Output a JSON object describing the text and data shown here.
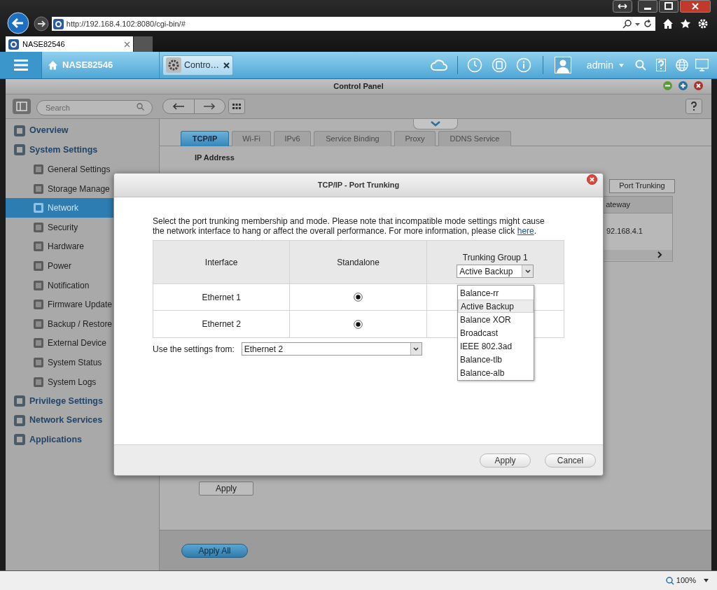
{
  "browser": {
    "url": "http://192.168.4.102:8080/cgi-bin/#",
    "tab": "NASE82546"
  },
  "app_header": {
    "host": "NASE82546",
    "open_app": "Contro…",
    "user": "admin"
  },
  "control_panel": {
    "title": "Control Panel",
    "search": {
      "placeholder": "Search"
    },
    "sidebar": [
      {
        "label": "Overview",
        "selected": false
      },
      {
        "label": "System Settings",
        "selected": false,
        "children": [
          {
            "label": "General Settings",
            "selected": false
          },
          {
            "label": "Storage Manage",
            "selected": false
          },
          {
            "label": "Network",
            "selected": true
          },
          {
            "label": "Security",
            "selected": false
          },
          {
            "label": "Hardware",
            "selected": false
          },
          {
            "label": "Power",
            "selected": false
          },
          {
            "label": "Notification",
            "selected": false
          },
          {
            "label": "Firmware Update",
            "selected": false
          },
          {
            "label": "Backup / Restore",
            "selected": false
          },
          {
            "label": "External Device",
            "selected": false
          },
          {
            "label": "System Status",
            "selected": false
          },
          {
            "label": "System Logs",
            "selected": false
          }
        ]
      },
      {
        "label": "Privilege Settings",
        "selected": false
      },
      {
        "label": "Network Services",
        "selected": false
      },
      {
        "label": "Applications",
        "selected": false
      }
    ],
    "tabs": [
      {
        "label": "TCP/IP",
        "selected": true
      },
      {
        "label": "Wi-Fi",
        "selected": false
      },
      {
        "label": "IPv6",
        "selected": false
      },
      {
        "label": "Service Binding",
        "selected": false
      },
      {
        "label": "Proxy",
        "selected": false
      },
      {
        "label": "DDNS Service",
        "selected": false
      }
    ],
    "section_label": "IP Address",
    "port_trunking_button": "Port Trunking",
    "column_header": "ateway",
    "cell": "92.168.4.1",
    "apply_button": "Apply",
    "apply_all_button": "Apply All"
  },
  "dialog": {
    "title": "TCP/IP - Port Trunking",
    "message": "Select the port trunking membership and mode. Please note that incompatible mode settings might cause the network interface to hang or affect the overall performance. For more information, please click",
    "link": "here",
    "after_link": ".",
    "columns": [
      "Interface",
      "Standalone",
      "Trunking Group 1"
    ],
    "group_mode": "Active Backup",
    "mode_options": [
      {
        "label": "Balance-rr",
        "selected": false
      },
      {
        "label": "Active Backup",
        "selected": true
      },
      {
        "label": "Balance XOR",
        "selected": false
      },
      {
        "label": "Broadcast",
        "selected": false
      },
      {
        "label": "IEEE 802.3ad",
        "selected": false
      },
      {
        "label": "Balance-tlb",
        "selected": false
      },
      {
        "label": "Balance-alb",
        "selected": false
      }
    ],
    "rows": [
      {
        "interface": "Ethernet 1",
        "standalone": true
      },
      {
        "interface": "Ethernet 2",
        "standalone": true
      }
    ],
    "settings_from": {
      "label": "Use the settings from:",
      "value": "Ethernet 2"
    },
    "buttons": [
      "Apply",
      "Cancel"
    ]
  },
  "status_bar": {
    "zoom": "100%"
  }
}
